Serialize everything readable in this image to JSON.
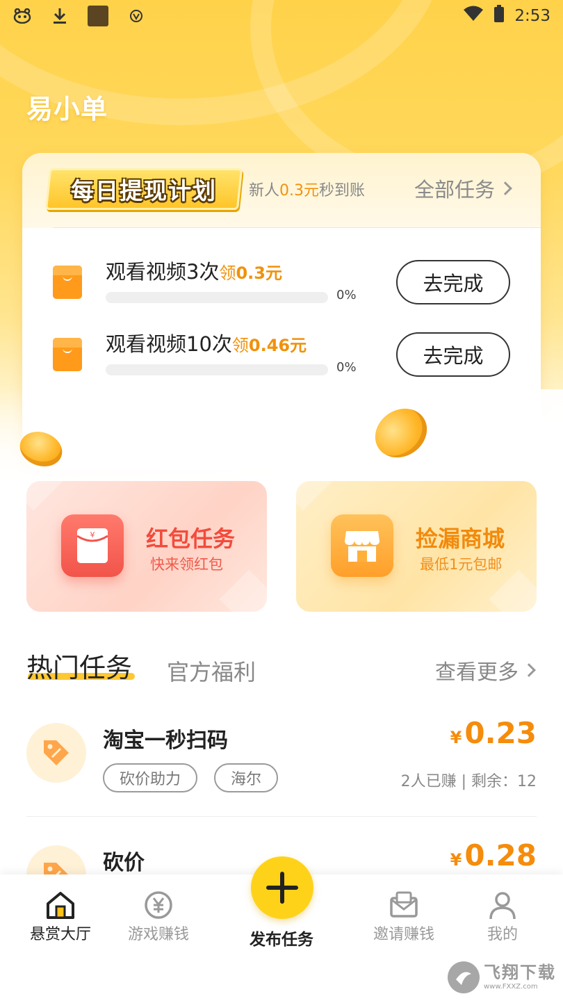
{
  "status_bar": {
    "time": "2:53"
  },
  "app": {
    "logo_text": "易小单"
  },
  "daily_plan": {
    "badge_title": "每日提现计划",
    "subtitle_prefix": "新人",
    "subtitle_amount": "0.3元",
    "subtitle_suffix": "秒到账",
    "all_tasks_label": "全部任务",
    "tasks": [
      {
        "title": "观看视频3次",
        "reward_prefix": "领",
        "reward": "0.3元",
        "progress_text": "0%",
        "progress": 0,
        "button_label": "去完成"
      },
      {
        "title": "观看视频10次",
        "reward_prefix": "领",
        "reward": "0.46元",
        "progress_text": "0%",
        "progress": 0,
        "button_label": "去完成"
      }
    ]
  },
  "promos": [
    {
      "title": "红包任务",
      "subtitle": "快来领红包",
      "icon": "red-envelope-icon"
    },
    {
      "title": "捡漏商城",
      "subtitle": "最低1元包邮",
      "icon": "shop-icon"
    }
  ],
  "section": {
    "active_tab": "热门任务",
    "inactive_tab": "官方福利",
    "see_more_label": "查看更多"
  },
  "hot_tasks": [
    {
      "title": "淘宝一秒扫码",
      "tags": [
        "砍价助力",
        "海尔"
      ],
      "currency": "¥",
      "price": "0.23",
      "meta": "2人已赚 | 剩余：12",
      "icon": "price-tag-icon"
    },
    {
      "title": "砍价",
      "tags": [],
      "currency": "¥",
      "price": "0.28",
      "meta": "",
      "icon": "price-tag-icon"
    }
  ],
  "bottom_nav": {
    "items": [
      {
        "label": "悬赏大厅",
        "icon": "home-icon",
        "active": true
      },
      {
        "label": "游戏赚钱",
        "icon": "yen-coin-icon",
        "active": false
      },
      {
        "label": "邀请赚钱",
        "icon": "mail-icon",
        "active": false
      },
      {
        "label": "我的",
        "icon": "user-icon",
        "active": false
      }
    ],
    "fab_label": "发布任务",
    "fab_icon": "plus-icon"
  },
  "watermark": {
    "main": "飞翔下载",
    "sub": "www.FXXZ.com"
  },
  "colors": {
    "accent": "#ffd21a",
    "orange": "#f58c0c",
    "red": "#f24b3d"
  }
}
